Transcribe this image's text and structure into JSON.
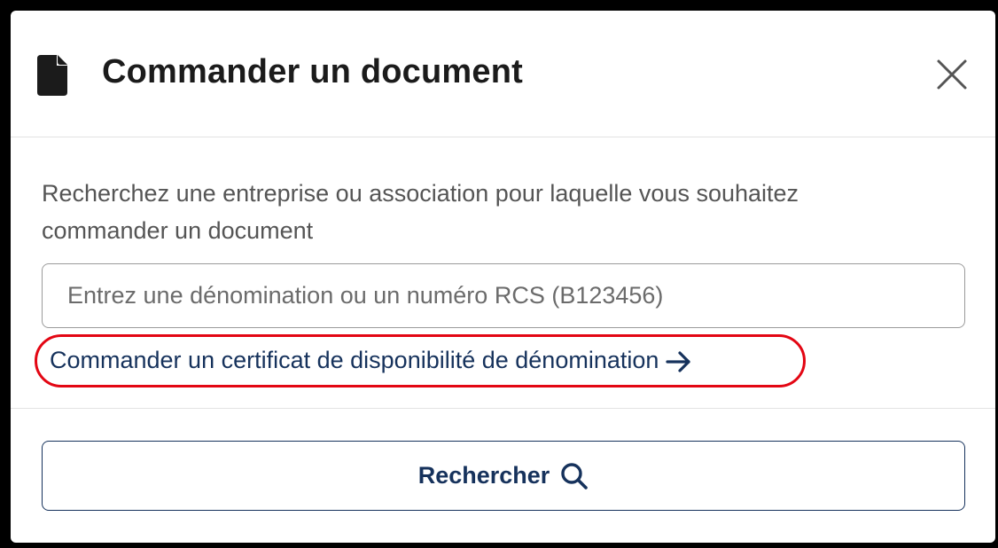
{
  "dialog": {
    "title": "Commander un document",
    "title_icon": "document-icon",
    "close_icon": "close-icon"
  },
  "body": {
    "description": "Recherchez une entreprise ou association pour laquelle vous souhaitez commander un document",
    "search": {
      "value": "",
      "placeholder": "Entrez une dénomination ou un numéro RCS (B123456)"
    },
    "certificate_link": {
      "label": "Commander un certificat de disponibilité de dénomination",
      "icon": "arrow-right-icon"
    }
  },
  "footer": {
    "search_button_label": "Rechercher",
    "search_button_icon": "search-icon"
  },
  "colors": {
    "text_primary": "#1b1b1b",
    "link": "#16325c",
    "highlight": "#e30613",
    "muted_text": "#555555"
  }
}
